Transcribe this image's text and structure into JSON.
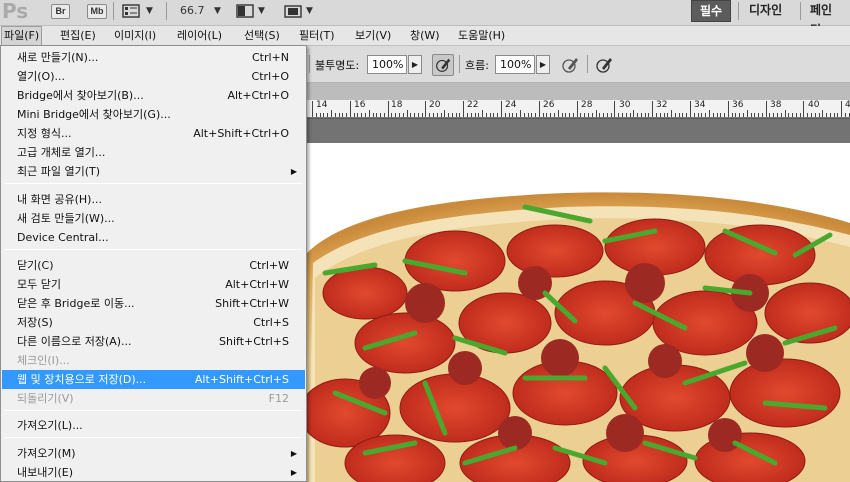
{
  "appbar": {
    "logo": "Ps",
    "br_label": "Br",
    "mb_label": "Mb",
    "zoom": "66.7",
    "workspaces": [
      "필수",
      "디자인",
      "페인팅"
    ]
  },
  "menubar": {
    "items": [
      "파일(F)",
      "편집(E)",
      "이미지(I)",
      "레이어(L)",
      "선택(S)",
      "필터(T)",
      "보기(V)",
      "창(W)",
      "도움말(H)"
    ]
  },
  "options": {
    "opacity_label": "불투명도:",
    "opacity_value": "100%",
    "flow_label": "흐름:",
    "flow_value": "100%"
  },
  "ruler": {
    "labels": [
      "14",
      "16",
      "18",
      "20",
      "22",
      "24",
      "26",
      "28",
      "30",
      "32",
      "34",
      "36",
      "38",
      "40",
      "4"
    ]
  },
  "file_menu": {
    "items": [
      {
        "label": "새로 만들기(N)...",
        "shortcut": "Ctrl+N"
      },
      {
        "label": "열기(O)...",
        "shortcut": "Ctrl+O"
      },
      {
        "label": "Bridge에서 찾아보기(B)...",
        "shortcut": "Alt+Ctrl+O"
      },
      {
        "label": "Mini Bridge에서 찾아보기(G)...",
        "shortcut": ""
      },
      {
        "label": "지정 형식...",
        "shortcut": "Alt+Shift+Ctrl+O"
      },
      {
        "label": "고급 개체로 열기...",
        "shortcut": ""
      },
      {
        "label": "최근 파일 열기(T)",
        "shortcut": "",
        "submenu": true
      },
      {
        "label": "내 화면 공유(H)...",
        "shortcut": ""
      },
      {
        "label": "새 검토 만들기(W)...",
        "shortcut": ""
      },
      {
        "label": "Device Central...",
        "shortcut": ""
      },
      {
        "label": "닫기(C)",
        "shortcut": "Ctrl+W"
      },
      {
        "label": "모두 닫기",
        "shortcut": "Alt+Ctrl+W"
      },
      {
        "label": "닫은 후 Bridge로 이동...",
        "shortcut": "Shift+Ctrl+W"
      },
      {
        "label": "저장(S)",
        "shortcut": "Ctrl+S"
      },
      {
        "label": "다른 이름으로 저장(A)...",
        "shortcut": "Shift+Ctrl+S"
      },
      {
        "label": "체크인(I)...",
        "shortcut": "",
        "disabled": true
      },
      {
        "label": "웹 및 장치용으로 저장(D)...",
        "shortcut": "Alt+Shift+Ctrl+S",
        "highlighted": true
      },
      {
        "label": "되돌리기(V)",
        "shortcut": "F12",
        "disabled": true
      },
      {
        "label": "가져오기(L)...",
        "shortcut": ""
      },
      {
        "label": "가져오기(M)",
        "shortcut": "",
        "submenu": true
      },
      {
        "label": "내보내기(E)",
        "shortcut": "",
        "submenu": true
      }
    ]
  }
}
